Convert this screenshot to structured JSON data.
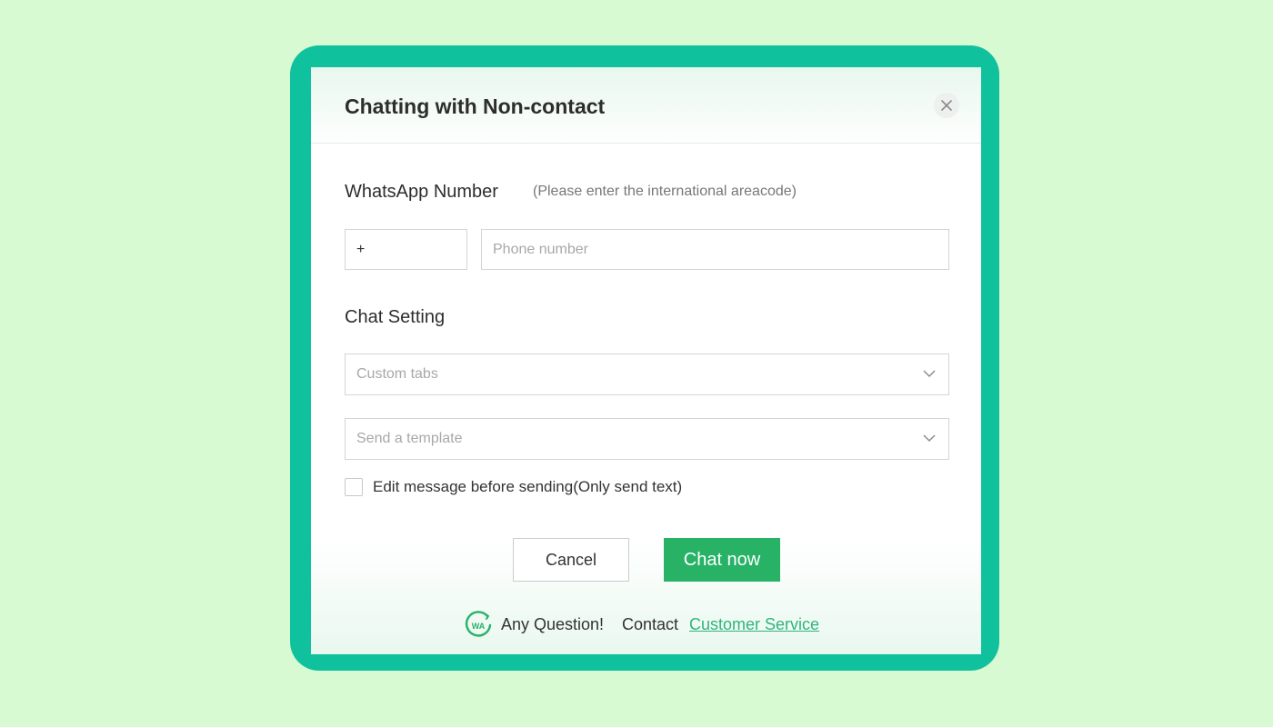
{
  "dialog": {
    "title": "Chatting with Non-contact",
    "close_icon": "close-icon"
  },
  "whatsapp": {
    "label": "WhatsApp Number",
    "hint": "(Please enter the international areacode)",
    "country_code_value": "+",
    "phone_placeholder": "Phone number"
  },
  "chat_setting": {
    "label": "Chat Setting",
    "custom_tabs_placeholder": "Custom tabs",
    "template_placeholder": "Send a template",
    "chevron_icon": "chevron-down-icon",
    "edit_checkbox_label": "Edit message before sending(Only send text)",
    "edit_checkbox_checked": false
  },
  "actions": {
    "cancel_label": "Cancel",
    "chat_now_label": "Chat now"
  },
  "footer": {
    "logo_text": "WA",
    "question_text": "Any Question!",
    "contact_text": "Contact",
    "link_text": "Customer Service"
  },
  "colors": {
    "background": "#d7fad3",
    "frame": "#0fc19c",
    "primary_button": "#27b266",
    "link": "#2fb57a"
  }
}
